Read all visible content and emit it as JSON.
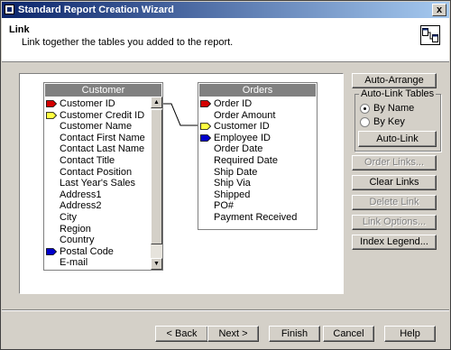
{
  "window": {
    "title": "Standard Report Creation Wizard",
    "close_label": "x"
  },
  "header": {
    "title": "Link",
    "subtitle": "Link together the tables you added to the report."
  },
  "tables": {
    "customer": {
      "title": "Customer",
      "fields": [
        {
          "name": "Customer ID",
          "key": "red"
        },
        {
          "name": "Customer Credit ID",
          "key": "yellow"
        },
        {
          "name": "Customer Name",
          "key": ""
        },
        {
          "name": "Contact First Name",
          "key": ""
        },
        {
          "name": "Contact Last Name",
          "key": ""
        },
        {
          "name": "Contact Title",
          "key": ""
        },
        {
          "name": "Contact Position",
          "key": ""
        },
        {
          "name": "Last Year's Sales",
          "key": ""
        },
        {
          "name": "Address1",
          "key": ""
        },
        {
          "name": "Address2",
          "key": ""
        },
        {
          "name": "City",
          "key": ""
        },
        {
          "name": "Region",
          "key": ""
        },
        {
          "name": "Country",
          "key": ""
        },
        {
          "name": "Postal Code",
          "key": "blue"
        },
        {
          "name": "E-mail",
          "key": ""
        }
      ]
    },
    "orders": {
      "title": "Orders",
      "fields": [
        {
          "name": "Order ID",
          "key": "red"
        },
        {
          "name": "Order Amount",
          "key": ""
        },
        {
          "name": "Customer ID",
          "key": "yellow"
        },
        {
          "name": "Employee ID",
          "key": "blue"
        },
        {
          "name": "Order Date",
          "key": ""
        },
        {
          "name": "Required Date",
          "key": ""
        },
        {
          "name": "Ship Date",
          "key": ""
        },
        {
          "name": "Ship Via",
          "key": ""
        },
        {
          "name": "Shipped",
          "key": ""
        },
        {
          "name": "PO#",
          "key": ""
        },
        {
          "name": "Payment Received",
          "key": ""
        }
      ]
    }
  },
  "side": {
    "auto_arrange": "Auto-Arrange",
    "auto_link_group": "Auto-Link Tables",
    "by_name": "By Name",
    "by_key": "By Key",
    "selected": "By Name",
    "auto_link": "Auto-Link",
    "order_links": "Order Links...",
    "clear_links": "Clear Links",
    "delete_link": "Delete Link",
    "link_options": "Link Options...",
    "index_legend": "Index Legend..."
  },
  "footer": {
    "back": "< Back",
    "next": "Next >",
    "finish": "Finish",
    "cancel": "Cancel",
    "help": "Help"
  },
  "colors": {
    "red": "#d40000",
    "yellow": "#ffff40",
    "blue": "#0000cc",
    "title_start": "#0a246a",
    "title_end": "#a6caf0"
  }
}
